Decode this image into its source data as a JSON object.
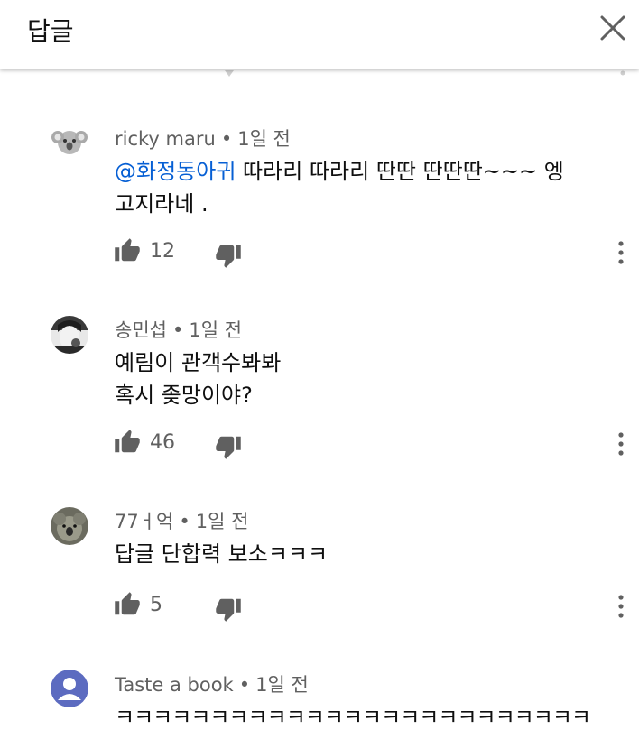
{
  "header": {
    "title": "답글",
    "close_icon": "close-icon"
  },
  "colors": {
    "mention": "#065fd4",
    "meta": "#606060",
    "text": "#0f0f0f"
  },
  "comments": [
    {
      "author": "ricky maru",
      "time": "1일 전",
      "mention": "@화정동아귀",
      "line1": " 따라리 따라리 딴딴 딴딴딴~~~ 엥",
      "line2": "고지라네 .",
      "likes": "12",
      "avatar_icon": "koala-avatar-icon"
    },
    {
      "author": "송민섭",
      "time": "1일 전",
      "line1": "예림이 관객수봐봐",
      "line2": "혹시 좆망이야?",
      "likes": "46",
      "avatar_icon": "person-photo-avatar"
    },
    {
      "author": "77ㅓ억",
      "time": "1일 전",
      "line1": "답글 단합력 보소ㅋㅋㅋ",
      "likes": "5",
      "avatar_icon": "animal-photo-avatar"
    },
    {
      "author": "Taste a book",
      "time": "1일 전",
      "line1": "ㅋㅋㅋㅋㅋㅋㅋㅋㅋㅋㅋㅋㅋㅋㅋㅋㅋㅋㅋㅋㅋㅋㅋㅋㅋ",
      "avatar_icon": "default-person-avatar-icon"
    }
  ]
}
